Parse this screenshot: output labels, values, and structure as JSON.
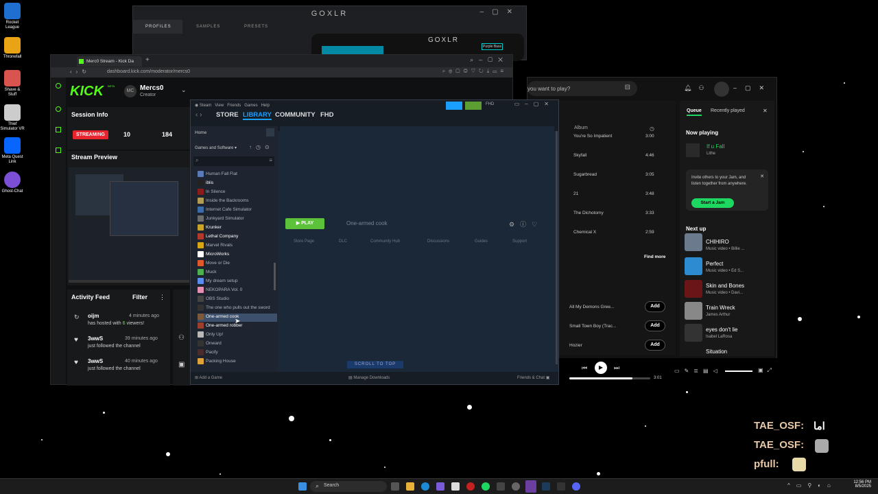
{
  "desktop": {
    "icons": [
      {
        "label": "Rocket League",
        "color": "#1f6fd1"
      },
      {
        "label": "Thronefall",
        "color": "#e8a317"
      },
      {
        "label": "Shave & Stuff",
        "color": "#d9534f"
      },
      {
        "label": "Thief Simulator VR",
        "color": "#cccccc"
      },
      {
        "label": "Meta Quest Link",
        "color": "#0866ff"
      },
      {
        "label": "Ghost-Chat",
        "color": "#7b4fd6"
      }
    ]
  },
  "goxlr": {
    "title": "GOXLR",
    "tabs": [
      "PROFILES",
      "SAMPLES",
      "PRESETS"
    ],
    "inner_title": "GOXLR",
    "badge": "Purple Bass"
  },
  "kick": {
    "tab_title": "Merc0 Stream - Kick Da",
    "url": "dashboard.kick.com/moderator/mercs0",
    "logo": "KICK",
    "logo_badge": "BETA",
    "channel": "Mercs0",
    "role": "Creator",
    "session_title": "Session Info",
    "streaming_label": "STREAMING",
    "stat1": "10",
    "stat2": "184",
    "preview_title": "Stream Preview",
    "activity_title": "Activity Feed",
    "filter_label": "Filter",
    "feed": [
      {
        "user": "oijm",
        "time": "4 minutes ago",
        "text_a": "has hosted with ",
        "count": "6",
        "text_b": " viewers!"
      },
      {
        "user": "3wwS",
        "time": "39 minutes ago",
        "text_a": "just followed the channel",
        "count": "",
        "text_b": ""
      },
      {
        "user": "3wwS",
        "time": "40 minutes ago",
        "text_a": "just followed the channel",
        "count": "",
        "text_b": ""
      }
    ]
  },
  "steam": {
    "menu": [
      "Steam",
      "View",
      "Friends",
      "Games",
      "Help"
    ],
    "nav": [
      "STORE",
      "LIBRARY",
      "COMMUNITY",
      "FHD"
    ],
    "user": "FHD",
    "home": "Home",
    "filter": "Games and Software",
    "games": [
      {
        "name": "Human Fall Flat",
        "color": "#5a7bb5",
        "bright": false
      },
      {
        "name": "iblis",
        "color": "#222222",
        "bright": true
      },
      {
        "name": "In Silence",
        "color": "#8b1c1c",
        "bright": false
      },
      {
        "name": "Inside the Backrooms",
        "color": "#b29b52",
        "bright": false
      },
      {
        "name": "Internet Cafe Simulator",
        "color": "#3b6ea8",
        "bright": false
      },
      {
        "name": "Junkyard Simulator",
        "color": "#6d6d6d",
        "bright": false
      },
      {
        "name": "Krunker",
        "color": "#c9a227",
        "bright": true
      },
      {
        "name": "Lethal Company",
        "color": "#b33a2b",
        "bright": true
      },
      {
        "name": "Marvel Rivals",
        "color": "#d6a617",
        "bright": false
      },
      {
        "name": "MicroWorks",
        "color": "#ffffff",
        "bright": true
      },
      {
        "name": "Move or Die",
        "color": "#e0592a",
        "bright": false
      },
      {
        "name": "Muck",
        "color": "#4caf50",
        "bright": false
      },
      {
        "name": "My dream setup",
        "color": "#5b8def",
        "bright": false
      },
      {
        "name": "NEKOPARA Vol. 0",
        "color": "#e78fb3",
        "bright": false
      },
      {
        "name": "OBS Studio",
        "color": "#444444",
        "bright": false
      },
      {
        "name": "The one who pulls out the sword",
        "color": "#333333",
        "bright": false
      },
      {
        "name": "One-armed cook",
        "color": "#7d5a3c",
        "bright": false
      },
      {
        "name": "One-armed robber",
        "color": "#9c3f2f",
        "bright": true
      },
      {
        "name": "Only Up!",
        "color": "#b8b8b8",
        "bright": false
      },
      {
        "name": "Onward",
        "color": "#333333",
        "bright": false
      },
      {
        "name": "Pacify",
        "color": "#4a2c2c",
        "bright": false
      },
      {
        "name": "Packing House",
        "color": "#e0a23a",
        "bright": false
      }
    ],
    "selected_index": 16,
    "play_label": "PLAY",
    "game_title": "One-armed cook",
    "subnav": [
      "Store Page",
      "DLC",
      "Community Hub",
      "Discussions",
      "Guides",
      "Support"
    ],
    "scroll_top": "SCROLL TO TOP",
    "add_game": "Add a Game",
    "manage_downloads": "Manage Downloads",
    "friends_chat": "Friends & Chat"
  },
  "spotify": {
    "search_placeholder": "you want to play?",
    "album_header": "Album",
    "tracks": [
      {
        "title": "You're So Impatient",
        "time": "3:00"
      },
      {
        "title": "Skyfall",
        "time": "4:46"
      },
      {
        "title": "Sugarbread",
        "time": "3:05"
      },
      {
        "title": "21",
        "time": "3:48"
      },
      {
        "title": "The Dichotomy",
        "time": "3:33"
      },
      {
        "title": "Chemical X",
        "time": "2:59"
      }
    ],
    "find_more": "Find more",
    "add_rows": [
      {
        "title": "All My Demons Gree..."
      },
      {
        "title": "Small Town Boy (Trac..."
      },
      {
        "title": "Hozier"
      }
    ],
    "add_label": "Add",
    "queue_tab": "Queue",
    "recent_tab": "Recently played",
    "now_playing_label": "Now playing",
    "now_playing": {
      "title": "If u Fall",
      "artist": "Lithe"
    },
    "jam_text": "Invite others to your Jam, and listen together from anywhere.",
    "jam_button": "Start a Jam",
    "next_up_label": "Next up",
    "next_up": [
      {
        "title": "CHIHIRO",
        "sub": "Music video • Billie ..."
      },
      {
        "title": "Perfect",
        "sub": "Music video • Ed S..."
      },
      {
        "title": "Skin and Bones",
        "sub": "Music video • Davi..."
      },
      {
        "title": "Train Wreck",
        "sub": "James Arthur"
      },
      {
        "title": "eyes don't lie",
        "sub": "Isabel LaRosa"
      },
      {
        "title": "Situation",
        "sub": ""
      }
    ],
    "elapsed": "3:01",
    "progress": 0.78
  },
  "chat_overlay": [
    {
      "user": "TAE_OSF:",
      "msg": "اما"
    },
    {
      "user": "TAE_OSF:",
      "msg": ""
    },
    {
      "user": "pfull:",
      "msg": ""
    }
  ],
  "taskbar": {
    "search_label": "Search",
    "time": "12:56 PM",
    "date": "8/5/2025"
  }
}
